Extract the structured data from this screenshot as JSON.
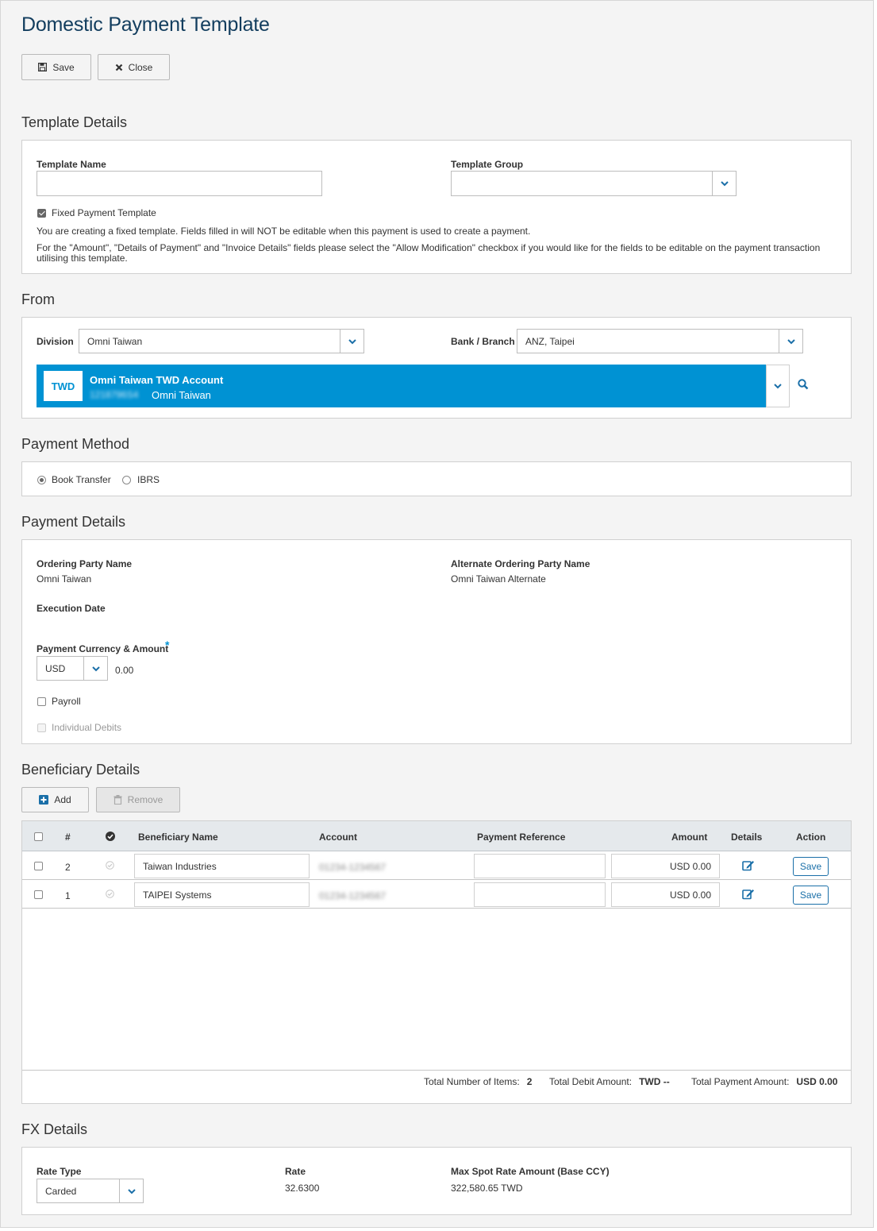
{
  "page": {
    "title": "Domestic Payment Template"
  },
  "toolbar": {
    "save_label": "Save",
    "close_label": "Close"
  },
  "template_details": {
    "section_title": "Template Details",
    "name_label": "Template Name",
    "name_value": "",
    "group_label": "Template Group",
    "group_value": "",
    "fixed_label": "Fixed Payment Template",
    "fixed_checked": true,
    "note1": "You are creating a fixed template. Fields filled in will NOT be editable when this payment is used to create a payment.",
    "note2": "For the \"Amount\", \"Details of Payment\" and \"Invoice Details\" fields please select the \"Allow Modification\" checkbox if you would like for the fields to be editable on the payment transaction utilising this template."
  },
  "from": {
    "section_title": "From",
    "division_label": "Division",
    "division_value": "Omni Taiwan",
    "bank_label": "Bank / Branch",
    "bank_value": "ANZ, Taipei",
    "account": {
      "currency": "TWD",
      "name": "Omni Taiwan TWD Account",
      "number": "1218796S4",
      "owner": "Omni Taiwan"
    }
  },
  "payment_method": {
    "section_title": "Payment Method",
    "options": [
      "Book Transfer",
      "IBRS"
    ],
    "selected": "Book Transfer"
  },
  "payment_details": {
    "section_title": "Payment Details",
    "ordering_party_label": "Ordering Party Name",
    "ordering_party_value": "Omni Taiwan",
    "alt_ordering_label": "Alternate Ordering Party Name",
    "alt_ordering_value": "Omni Taiwan Alternate",
    "execution_date_label": "Execution Date",
    "currency_amount_label": "Payment Currency & Amount",
    "required_mark": "*",
    "currency": "USD",
    "amount": "0.00",
    "payroll_label": "Payroll",
    "individual_debits_label": "Individual Debits"
  },
  "beneficiary": {
    "section_title": "Beneficiary Details",
    "add_label": "Add",
    "remove_label": "Remove",
    "columns": {
      "num": "#",
      "name": "Beneficiary Name",
      "account": "Account",
      "reference": "Payment Reference",
      "amount": "Amount",
      "details": "Details",
      "action": "Action"
    },
    "rows": [
      {
        "num": "2",
        "name": "Taiwan Industries",
        "account": "01234-1234567",
        "reference": "",
        "amount": "USD 0.00",
        "action": "Save"
      },
      {
        "num": "1",
        "name": "TAIPEI Systems",
        "account": "01234-1234567",
        "reference": "",
        "amount": "USD 0.00",
        "action": "Save"
      }
    ],
    "totals": {
      "items_label": "Total Number of Items:",
      "items_value": "2",
      "debit_label": "Total Debit Amount:",
      "debit_value": "TWD --",
      "payment_label": "Total Payment Amount:",
      "payment_value": "USD 0.00"
    }
  },
  "fx": {
    "section_title": "FX Details",
    "rate_type_label": "Rate Type",
    "rate_type_value": "Carded",
    "rate_label": "Rate",
    "rate_value": "32.6300",
    "max_spot_label": "Max Spot Rate Amount (Base CCY)",
    "max_spot_value": "322,580.65 TWD"
  },
  "colors": {
    "accent": "#0092d3",
    "title": "#123d5e",
    "link": "#1a6fa8"
  }
}
